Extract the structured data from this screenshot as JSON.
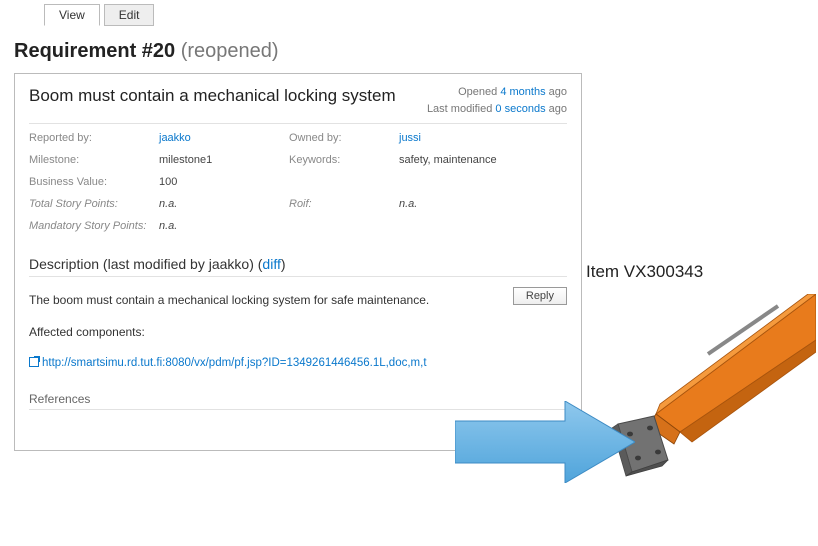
{
  "tabs": {
    "view": "View",
    "edit": "Edit"
  },
  "title": {
    "main": "Requirement #20",
    "status": "(reopened)"
  },
  "summary": "Boom must contain a mechanical locking system",
  "meta": {
    "opened_prefix": "Opened ",
    "opened_link": "4 months",
    "opened_suffix": " ago",
    "modified_prefix": "Last modified ",
    "modified_link": "0 seconds",
    "modified_suffix": " ago"
  },
  "fields": {
    "reported_by_label": "Reported by:",
    "reported_by_value": "jaakko",
    "owned_by_label": "Owned by:",
    "owned_by_value": "jussi",
    "milestone_label": "Milestone:",
    "milestone_value": "milestone1",
    "keywords_label": "Keywords:",
    "keywords_value": "safety, maintenance",
    "bv_label": "Business Value:",
    "bv_value": "100",
    "tsp_label": "Total Story Points:",
    "tsp_value": "n.a.",
    "roif_label": "Roif:",
    "roif_value": "n.a.",
    "msp_label": "Mandatory Story Points:",
    "msp_value": "n.a."
  },
  "description": {
    "heading_prefix": "Description (last modified by jaakko) (",
    "diff": "diff",
    "heading_suffix": ")",
    "body": "The boom must contain a mechanical locking system for safe maintenance.",
    "affected_label": "Affected components:",
    "url": "http://smartsimu.rd.tut.fi:8080/vx/pdm/pf.jsp?ID=1349261446456.1L,doc,m,t"
  },
  "reply": "Reply",
  "references_label": "References",
  "item_label": "Item VX300343"
}
